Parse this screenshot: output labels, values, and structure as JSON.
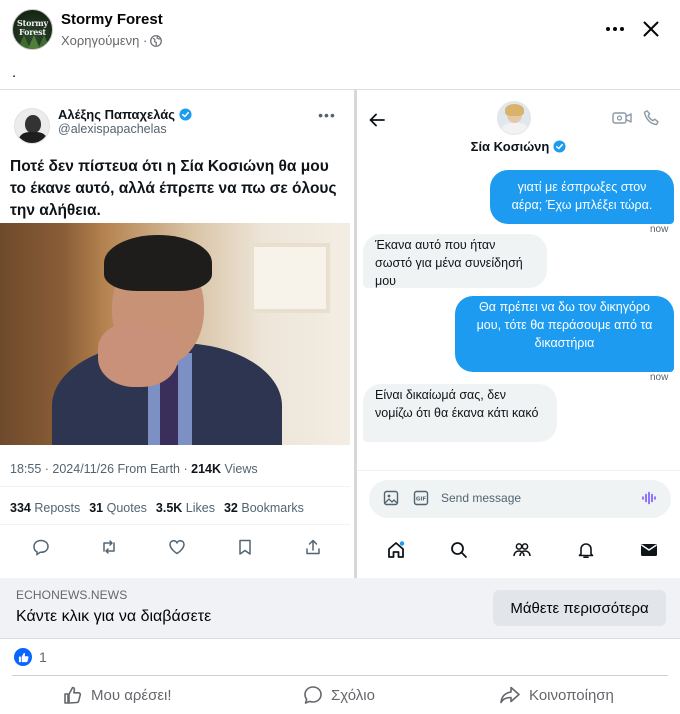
{
  "header": {
    "page_name": "Stormy Forest",
    "avatar_text": "Stormy Forest",
    "meta": "Χορηγούμενη ·",
    "post_text": "."
  },
  "tweet": {
    "author_name": "Αλέξης Παπαχελάς",
    "handle": "@alexispapachelas",
    "text": "Ποτέ δεν πίστευα ότι η Σία Κοσιώνη θα μου το έκανε αυτό, αλλά έπρεπε να πω σε όλους την αλήθεια.",
    "timestamp": "18:55 · 2024/11/26 From Earth ·",
    "views_count": "214K",
    "views_label": "Views",
    "stats": [
      {
        "count": "334",
        "label": "Reposts"
      },
      {
        "count": "31",
        "label": "Quotes"
      },
      {
        "count": "3.5K",
        "label": "Likes"
      },
      {
        "count": "32",
        "label": "Bookmarks"
      }
    ]
  },
  "dm": {
    "contact_name": "Σία Κοσιώνη",
    "messages": [
      {
        "text": "γιατί με έσπρωξες στον αέρα; Έχω μπλέξει τώρα.",
        "time": "now"
      },
      {
        "text": "Έκανα αυτό που ήταν σωστό για μένα συνείδησή μου"
      },
      {
        "text": "Θα πρέπει να δω τον δικηγόρο μου, τότε θα περάσουμε από τα δικαστήρια",
        "time": "now"
      },
      {
        "text": "Είναι δικαίωμά σας, δεν νομίζω ότι θα έκανα κάτι κακό"
      }
    ],
    "compose_placeholder": "Send message"
  },
  "link_preview": {
    "domain": "ECHONEWS.NEWS",
    "title": "Κάντε κλικ για να διαβάσετε",
    "button": "Μάθετε περισσότερα"
  },
  "reactions": {
    "count": "1"
  },
  "actions": {
    "like": "Μου αρέσει!",
    "comment": "Σχόλιο",
    "share": "Κοινοποίηση"
  },
  "colors": {
    "facebook_blue": "#0866ff",
    "twitter_blue": "#1d9bf0",
    "verified": "#1d9bf0"
  }
}
